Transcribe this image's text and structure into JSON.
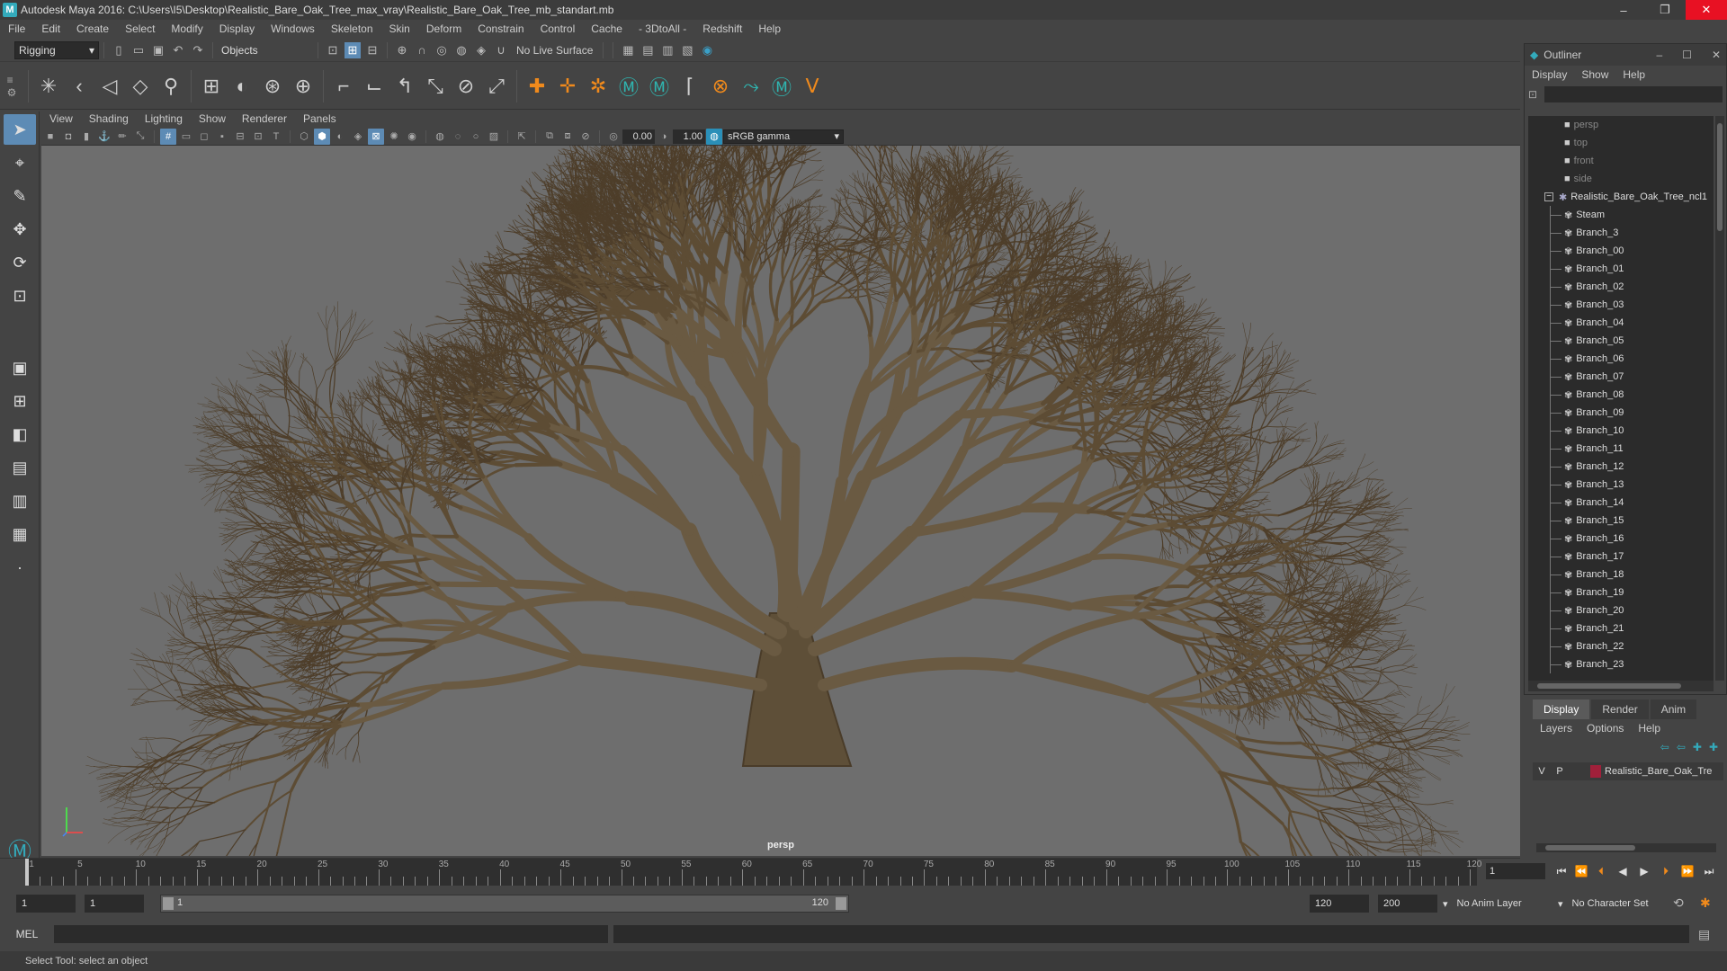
{
  "window": {
    "title": "Autodesk Maya 2016: C:\\Users\\I5\\Desktop\\Realistic_Bare_Oak_Tree_max_vray\\Realistic_Bare_Oak_Tree_mb_standart.mb",
    "minimize": "–",
    "maximize": "❐",
    "close": "✕"
  },
  "menubar": [
    "File",
    "Edit",
    "Create",
    "Select",
    "Modify",
    "Display",
    "Windows",
    "Skeleton",
    "Skin",
    "Deform",
    "Constrain",
    "Control",
    "Cache",
    "- 3DtoAll -",
    "Redshift",
    "Help"
  ],
  "statusline": {
    "mode": "Rigging",
    "selection_mask": "Objects",
    "live_surface": "No Live Surface"
  },
  "viewport": {
    "menu": [
      "View",
      "Shading",
      "Lighting",
      "Show",
      "Renderer",
      "Panels"
    ],
    "exposure": "0.00",
    "gamma": "1.00",
    "colorspace": "sRGB gamma",
    "camera_label": "persp"
  },
  "outliner": {
    "title": "Outliner",
    "menu": [
      "Display",
      "Show",
      "Help"
    ],
    "cameras": [
      "persp",
      "top",
      "front",
      "side"
    ],
    "root": "Realistic_Bare_Oak_Tree_ncl1",
    "children": [
      "Steam",
      "Branch_3",
      "Branch_00",
      "Branch_01",
      "Branch_02",
      "Branch_03",
      "Branch_04",
      "Branch_05",
      "Branch_06",
      "Branch_07",
      "Branch_08",
      "Branch_09",
      "Branch_10",
      "Branch_11",
      "Branch_12",
      "Branch_13",
      "Branch_14",
      "Branch_15",
      "Branch_16",
      "Branch_17",
      "Branch_18",
      "Branch_19",
      "Branch_20",
      "Branch_21",
      "Branch_22",
      "Branch_23"
    ]
  },
  "layer_editor": {
    "tabs": [
      "Display",
      "Render",
      "Anim"
    ],
    "menu": [
      "Layers",
      "Options",
      "Help"
    ],
    "layer": {
      "v": "V",
      "p": "P",
      "name": "Realistic_Bare_Oak_Tre",
      "color": "#a0203a"
    }
  },
  "timeslider": {
    "labels": [
      "1",
      "5",
      "10",
      "15",
      "20",
      "25",
      "30",
      "35",
      "40",
      "45",
      "50",
      "55",
      "60",
      "65",
      "70",
      "75",
      "80",
      "85",
      "90",
      "95",
      "100",
      "105",
      "110",
      "115",
      "120"
    ],
    "current_frame": "1"
  },
  "range": {
    "start": "1",
    "playback_start": "1",
    "bar_start": "1",
    "bar_end": "120",
    "playback_end": "120",
    "end": "200",
    "anim_layer": "No Anim Layer",
    "char_set": "No Character Set"
  },
  "cmdline": {
    "lang": "MEL"
  },
  "helpline": {
    "text": "Select Tool: select an object"
  }
}
